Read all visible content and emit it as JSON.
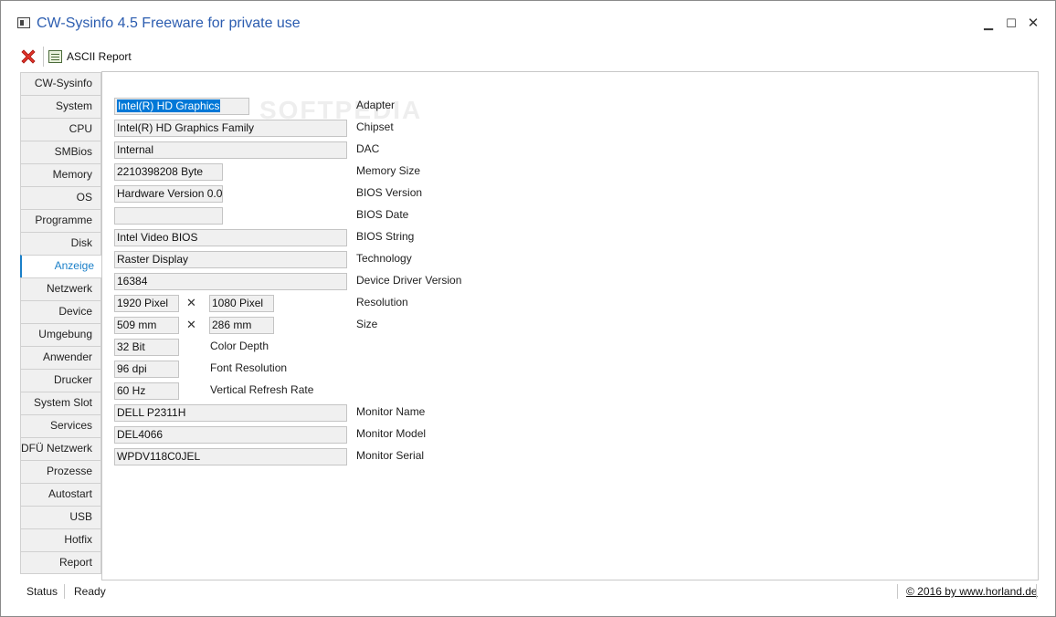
{
  "window": {
    "title": "CW-Sysinfo 4.5 Freeware for private use",
    "minimize_glyph": "▁",
    "maximize_glyph": "☐",
    "close_glyph": "✕"
  },
  "toolbar": {
    "close_icon": "red-x-icon",
    "report_label": "ASCII Report"
  },
  "sidebar": {
    "tabs": [
      "CW-Sysinfo",
      "System",
      "CPU",
      "SMBios",
      "Memory",
      "OS",
      "Programme",
      "Disk",
      "Anzeige",
      "Netzwerk",
      "Device",
      "Umgebung",
      "Anwender",
      "Drucker",
      "System Slot",
      "Services",
      "DFÜ Netzwerk",
      "Prozesse",
      "Autostart",
      "USB",
      "Hotfix",
      "Report"
    ],
    "active": "Anzeige"
  },
  "watermark": "SOFTPEDIA",
  "display": {
    "adapter": {
      "value": "Intel(R) HD Graphics",
      "label": "Adapter"
    },
    "chipset": {
      "value": "Intel(R) HD Graphics Family",
      "label": "Chipset"
    },
    "dac": {
      "value": "Internal",
      "label": "DAC"
    },
    "memory_size": {
      "value": "2210398208 Byte",
      "label": "Memory Size"
    },
    "bios_version": {
      "value": "Hardware Version 0.0",
      "label": "BIOS Version"
    },
    "bios_date": {
      "value": "",
      "label": "BIOS Date"
    },
    "bios_string": {
      "value": "Intel Video BIOS",
      "label": "BIOS String"
    },
    "technology": {
      "value": "Raster Display",
      "label": "Technology"
    },
    "driver_version": {
      "value": "16384",
      "label": "Device Driver Version"
    },
    "resolution": {
      "width": "1920 Pixel",
      "height": "1080 Pixel",
      "label": "Resolution"
    },
    "size": {
      "width": "509 mm",
      "height": "286 mm",
      "label": "Size"
    },
    "times_glyph": "✕",
    "color_depth": {
      "value": "32 Bit",
      "label": "Color Depth"
    },
    "font_resolution": {
      "value": "96 dpi",
      "label": "Font Resolution"
    },
    "refresh_rate": {
      "value": "60 Hz",
      "label": "Vertical Refresh Rate"
    },
    "monitor_name": {
      "value": "DELL P2311H",
      "label": "Monitor Name"
    },
    "monitor_model": {
      "value": "DEL4066",
      "label": "Monitor Model"
    },
    "monitor_serial": {
      "value": "WPDV118C0JEL",
      "label": "Monitor Serial"
    }
  },
  "statusbar": {
    "label": "Status",
    "value": "Ready",
    "link": "© 2016 by www.horland.de"
  }
}
